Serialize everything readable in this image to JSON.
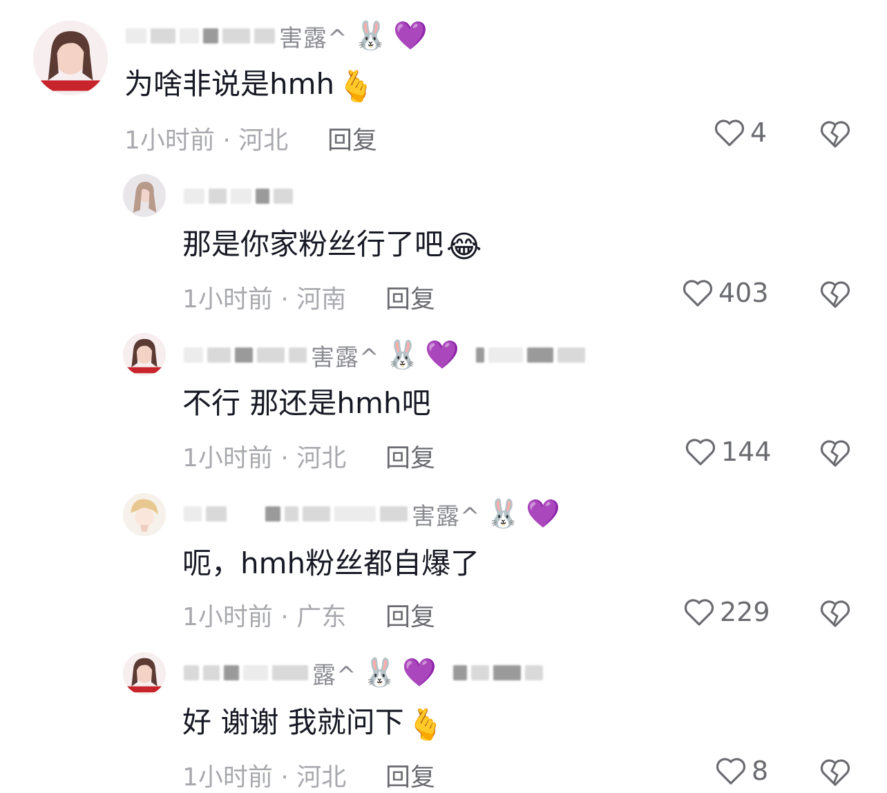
{
  "comments": [
    {
      "name_visible": "害露^",
      "emojis": [
        "🐰",
        "💜"
      ],
      "text": "为啥非说是hmh",
      "text_emoji": "🫰",
      "time": "1小时前",
      "location": "河北",
      "reply_label": "回复",
      "likes": "4"
    },
    {
      "name_visible": "",
      "emojis": [],
      "text": "那是你家粉丝行了吧",
      "text_emoji": "😂",
      "time": "1小时前",
      "location": "河南",
      "reply_label": "回复",
      "likes": "403"
    },
    {
      "name_visible": "害露^",
      "emojis": [
        "🐰",
        "💜"
      ],
      "text": "不行 那还是hmh吧",
      "text_emoji": "",
      "time": "1小时前",
      "location": "河北",
      "reply_label": "回复",
      "likes": "144"
    },
    {
      "name_visible": "害露^",
      "emojis": [
        "🐰",
        "💜"
      ],
      "text": "呃，hmh粉丝都自爆了",
      "text_emoji": "",
      "time": "1小时前",
      "location": "广东",
      "reply_label": "回复",
      "likes": "229"
    },
    {
      "name_visible": "露^",
      "emojis": [
        "🐰",
        "💜"
      ],
      "text": "好 谢谢 我就问下",
      "text_emoji": "🫰",
      "time": "1小时前",
      "location": "河北",
      "reply_label": "回复",
      "likes": "8"
    }
  ],
  "separator": "·",
  "icons": {
    "like": "heart-outline-icon",
    "dislike": "broken-heart-icon"
  },
  "colors": {
    "text": "#161823",
    "meta": "#a8a9ae",
    "action": "#6a6b70"
  }
}
